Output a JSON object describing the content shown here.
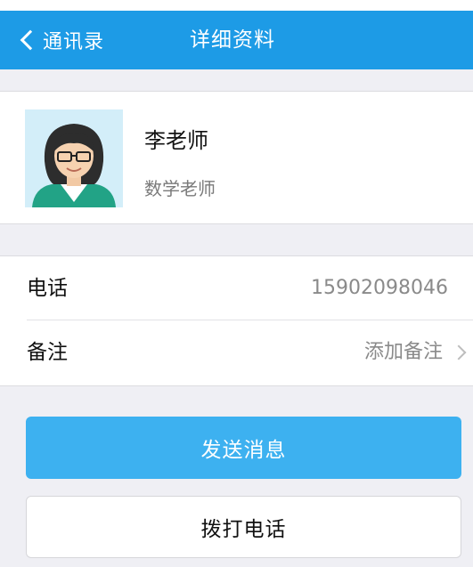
{
  "nav": {
    "back_label": "通讯录",
    "title": "详细资料"
  },
  "contact": {
    "name": "李老师",
    "title": "数学老师",
    "avatar_icon": "teacher-avatar"
  },
  "info": {
    "phone_label": "电话",
    "phone_value": "15902098046",
    "note_label": "备注",
    "note_value": "添加备注"
  },
  "actions": {
    "send_message": "发送消息",
    "call": "拨打电话"
  },
  "colors": {
    "nav_bg": "#1d9be6",
    "primary_button": "#3db1f0",
    "background": "#efeff4"
  }
}
